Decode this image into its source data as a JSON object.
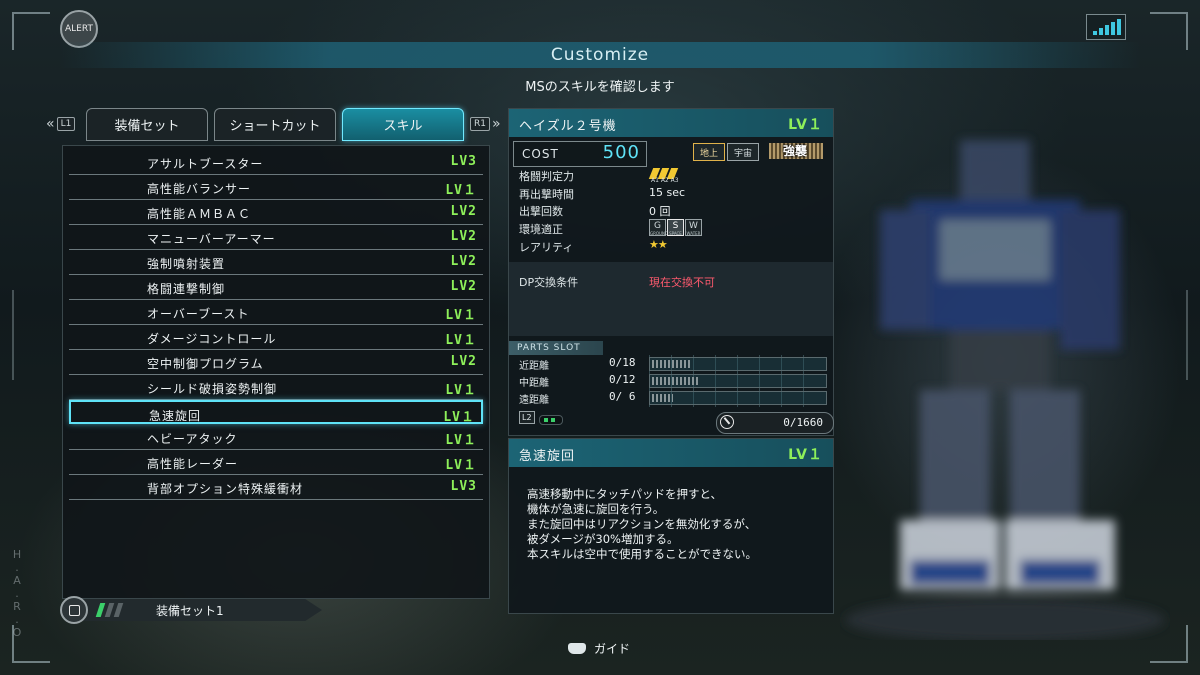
{
  "header": {
    "alert": "ALERT",
    "title": "Customize",
    "subtitle": "MSのスキルを確認します"
  },
  "tabs": {
    "left_key": "L1",
    "right_key": "R1",
    "items": [
      {
        "label": "装備セット",
        "active": false
      },
      {
        "label": "ショートカット",
        "active": false
      },
      {
        "label": "スキル",
        "active": true
      }
    ]
  },
  "skills": [
    {
      "name": "アサルトブースター",
      "level": "LV3"
    },
    {
      "name": "高性能バランサー",
      "level": "LV１"
    },
    {
      "name": "高性能ＡＭＢＡＣ",
      "level": "LV2"
    },
    {
      "name": "マニューバーアーマー",
      "level": "LV2"
    },
    {
      "name": "強制噴射装置",
      "level": "LV2"
    },
    {
      "name": "格闘連撃制御",
      "level": "LV2"
    },
    {
      "name": "オーバーブースト",
      "level": "LV１"
    },
    {
      "name": "ダメージコントロール",
      "level": "LV１"
    },
    {
      "name": "空中制御プログラム",
      "level": "LV2"
    },
    {
      "name": "シールド破損姿勢制御",
      "level": "LV１"
    },
    {
      "name": "急速旋回",
      "level": "LV１",
      "selected": true
    },
    {
      "name": "ヘビーアタック",
      "level": "LV１"
    },
    {
      "name": "高性能レーダー",
      "level": "LV１"
    },
    {
      "name": "背部オプション特殊緩衝材",
      "level": "LV3"
    }
  ],
  "loadout": {
    "label": "装備セット1"
  },
  "unit": {
    "name": "ヘイズル２号機",
    "level": "LV１",
    "cost_label": "COST",
    "cost": "500",
    "terrain": [
      "地上",
      "宇宙"
    ],
    "role": "強襲",
    "stats": {
      "melee_label": "格闘判定力",
      "melee_sub": "A1 A2 A3",
      "respawn_label": "再出撃時間",
      "respawn_value": "15 sec",
      "sorties_label": "出撃回数",
      "sorties_value": "0 回",
      "env_label": "環境適正",
      "env": [
        {
          "letter": "G",
          "sub": "GROUND",
          "active": false
        },
        {
          "letter": "S",
          "sub": "SPACE",
          "active": true
        },
        {
          "letter": "W",
          "sub": "WATER",
          "active": false
        }
      ],
      "rarity_label": "レアリティ",
      "rarity": "★★"
    },
    "dp": {
      "label": "DP交換条件",
      "value": "現在交換不可"
    },
    "parts": {
      "title": "PARTS SLOT",
      "rows": [
        {
          "label": "近距離",
          "value": "0/18",
          "fill": 0.22
        },
        {
          "label": "中距離",
          "value": "0/12",
          "fill": 0.27
        },
        {
          "label": "遠距離",
          "value": "0/ 6",
          "fill": 0.12
        }
      ],
      "page_key": "L2"
    },
    "weight": "0/1660"
  },
  "detail": {
    "name": "急速旋回",
    "level": "LV１",
    "lines": [
      "高速移動中にタッチパッドを押すと、",
      "機体が急速に旋回を行う。",
      "また旋回中はリアクションを無効化するが、",
      "被ダメージが30%増加する。",
      "本スキルは空中で使用することができない。"
    ]
  },
  "guide": {
    "label": "ガイド"
  },
  "watermark": "H.A.R.O",
  "colors": {
    "accent": "#5fe3f7",
    "level": "#8ef05a",
    "warning": "#ff5a6e",
    "header": "#1c6475"
  }
}
